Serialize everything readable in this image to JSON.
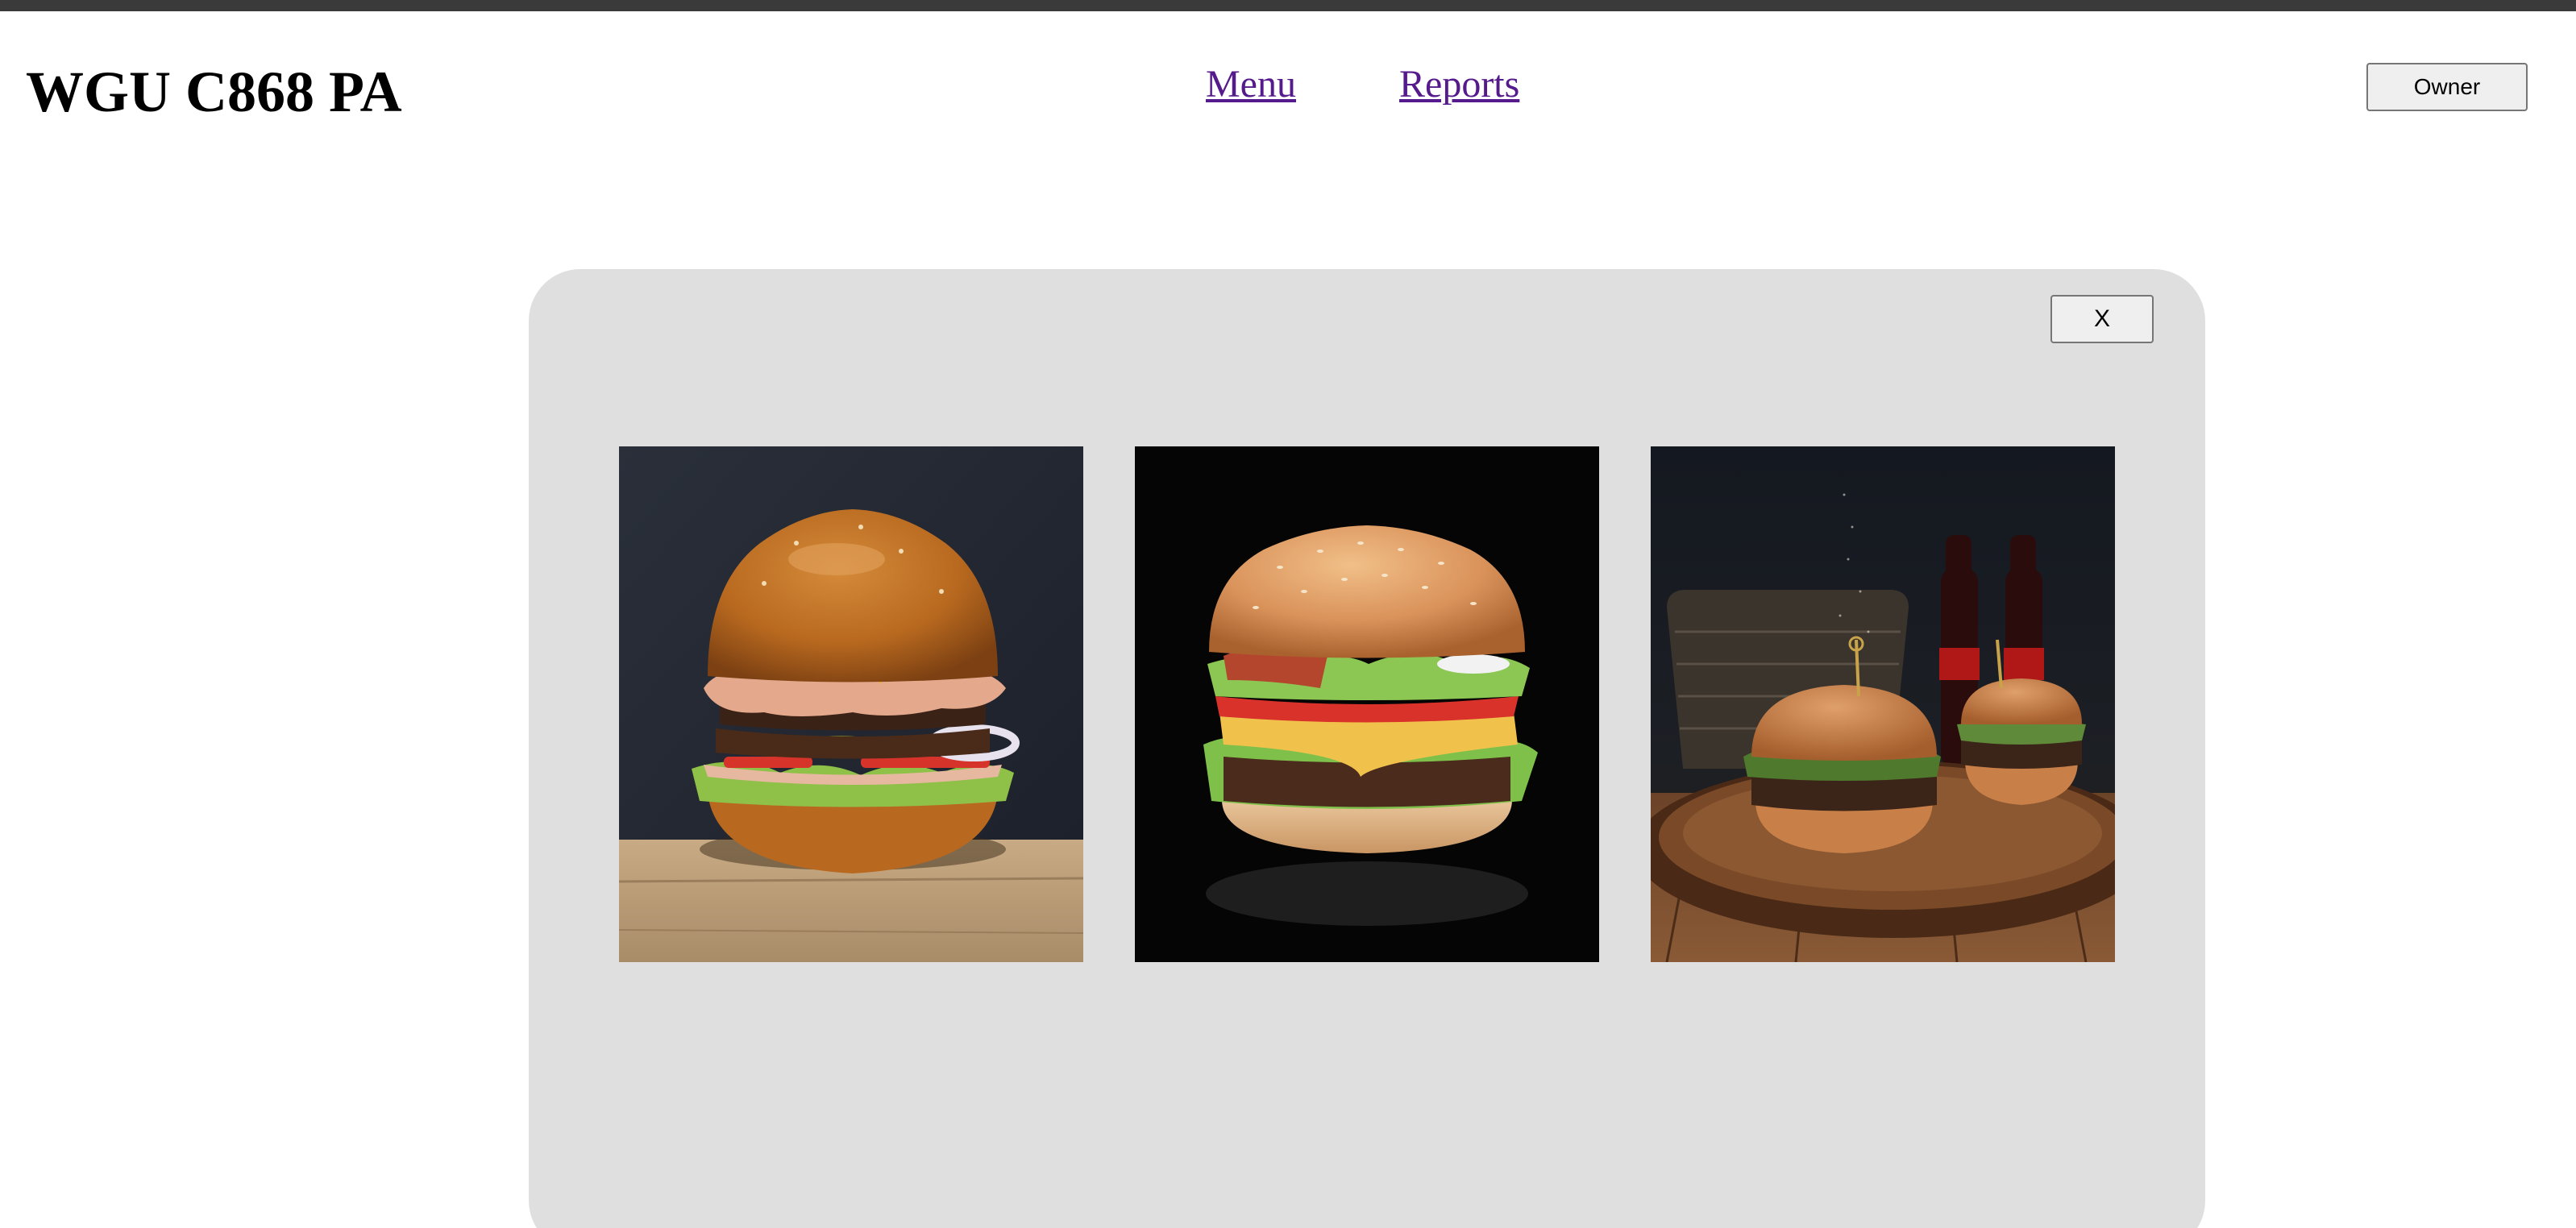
{
  "header": {
    "title": "WGU C868 PA",
    "nav": [
      {
        "label": "Menu"
      },
      {
        "label": "Reports"
      }
    ],
    "owner_button_label": "Owner"
  },
  "modal": {
    "close_label": "X",
    "images": [
      {
        "subject": "double cheeseburger on wooden board, dark blue background"
      },
      {
        "subject": "cheeseburger with bacon and lettuce, black background"
      },
      {
        "subject": "two burgers on wooden tray with cola bottles"
      }
    ]
  }
}
